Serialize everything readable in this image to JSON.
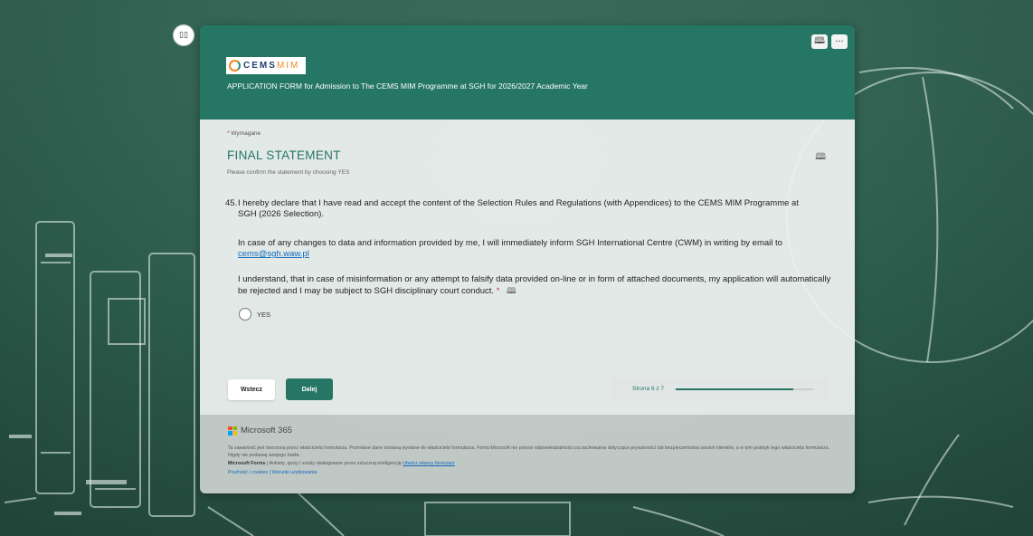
{
  "colors": {
    "accent": "#257665",
    "required": "#c4314b",
    "link": "#0f6cbd",
    "board": "#2f5c4d"
  },
  "toolbar": {
    "immersive_label": "▯▯",
    "header_icons": [
      "immersive-reader-icon",
      "more-options-icon"
    ],
    "immersive_reader_glyph": "🕮",
    "more_glyph": "···"
  },
  "form": {
    "logo_text": "CEMS",
    "logo_text_accent": "MIM",
    "title": "APPLICATION FORM for Admission to The CEMS MIM Programme at SGH for 2026/2027 Academic Year",
    "required_asterisk": "*",
    "required_note": "Wymagane",
    "section_title": "FINAL STATEMENT",
    "section_description": "Please confirm the statement by choosing YES",
    "question": {
      "number": "45.",
      "para1": "I hereby declare that I have read and accept the content of the Selection Rules and Regulations (with Appendices) to the CEMS MIM Programme at SGH (2026 Selection).",
      "para2_text": "In case of any changes to data and information provided by me, I will immediately inform SGH International Centre (CWM) in writing by email to ",
      "para2_link": "cems@sgh.waw.pl",
      "para3": "I understand, that in case of misinformation or any attempt to falsify data provided on-line or in form of attached documents, my application will automatically be rejected and I may be subject to SGH disciplinary court conduct.",
      "required_mark": "*",
      "option": "YES"
    },
    "buttons": {
      "back": "Wstecz",
      "next": "Dalej"
    },
    "progress": {
      "label": "Strona 6 z 7",
      "fraction": 0.857
    }
  },
  "footer": {
    "brand": "Microsoft 365",
    "disclaimer": "Ta zawartość jest tworzona przez właściciela formularza. Przesłane dane zostaną wysłane do właściciela formularza. Firma Microsoft nie ponosi odpowiedzialności za zachowania dotyczące prywatności lub bezpieczeństwa swoich klientów, a w tym praktyk tego właściciela formularza. Nigdy nie podawaj swojego hasła.",
    "forms_brand": "Microsoft Forms",
    "forms_text": " | Ankiety, quizy i sondy obsługiwane przez sztuczną inteligencję ",
    "forms_link": "Utwórz własny formularz",
    "links": "Poufność i cookies | Warunki użytkowania"
  }
}
